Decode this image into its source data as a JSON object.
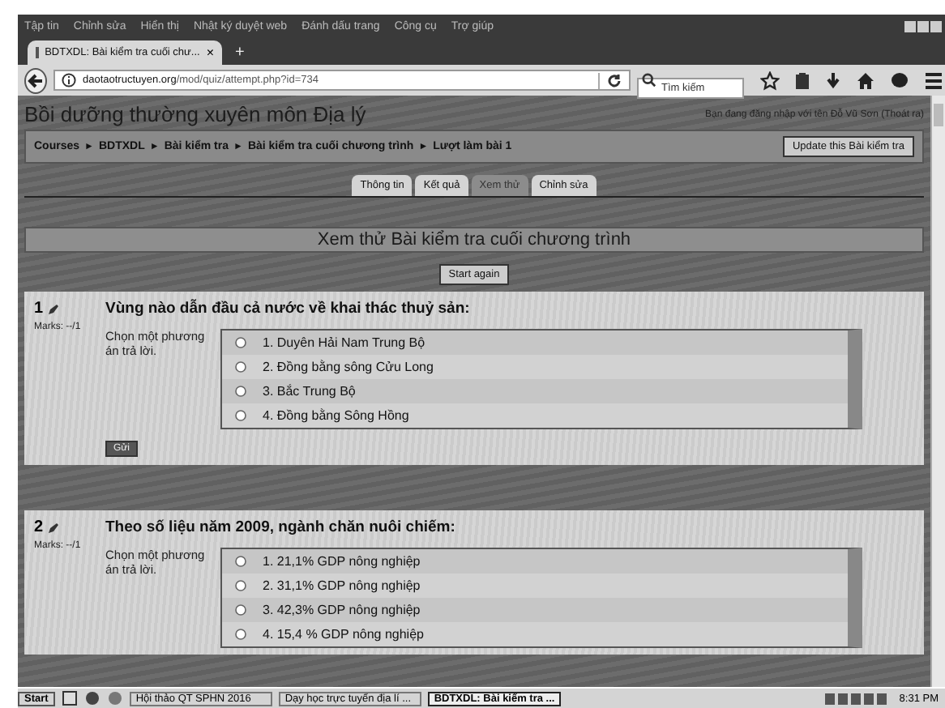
{
  "browser": {
    "menu": [
      "Tập tin",
      "Chỉnh sửa",
      "Hiển thị",
      "Nhật ký duyệt web",
      "Đánh dấu trang",
      "Công cụ",
      "Trợ giúp"
    ],
    "tab": {
      "title": "BDTXDL: Bài kiểm tra cuối chư...",
      "close": "×",
      "new_tab": "+"
    },
    "url": {
      "domain": "daotaotructuyen.org",
      "path": "/mod/quiz/attempt.php?id=734"
    },
    "search": {
      "placeholder": "Tìm kiếm"
    }
  },
  "site": {
    "title": "Bồi dưỡng thường xuyên môn Địa lý",
    "login_text": "Bạn đang đăng nhập với tên Đỗ Vũ Sơn (",
    "logout_link": "Thoát ra",
    "login_end": ")"
  },
  "breadcrumbs": [
    "Courses",
    "BDTXDL",
    "Bài kiểm tra",
    "Bài kiểm tra cuối chương trình",
    "Lượt làm bài 1"
  ],
  "breadcrumb_separator": "►",
  "update_button": "Update this Bài kiểm tra",
  "tabs": [
    {
      "label": "Thông tin",
      "selected": false
    },
    {
      "label": "Kết quả",
      "selected": false
    },
    {
      "label": "Xem thử",
      "selected": true
    },
    {
      "label": "Chỉnh sửa",
      "selected": false
    }
  ],
  "heading": "Xem thử Bài kiểm tra cuối chương trình",
  "start_again": "Start again",
  "questions": [
    {
      "number": "1",
      "marks": "Marks: --/1",
      "prompt": "Chọn một phương án trả lời.",
      "text": "Vùng nào dẫn đầu cả nước về khai thác thuỷ sản:",
      "submit": "Gửi",
      "options": [
        {
          "label": "1. Duyên Hải Nam Trung Bộ",
          "selected": false
        },
        {
          "label": "2. Đồng bằng sông Cửu Long",
          "selected": false
        },
        {
          "label": "3. Bắc Trung Bộ",
          "selected": false
        },
        {
          "label": "4. Đồng bằng Sông Hồng",
          "selected": false
        }
      ]
    },
    {
      "number": "2",
      "marks": "Marks: --/1",
      "prompt": "Chọn một phương án trả lời.",
      "text": "Theo số liệu năm 2009, ngành chăn nuôi chiếm:",
      "options": [
        {
          "label": "1. 21,1% GDP nông nghiệp",
          "selected": false
        },
        {
          "label": "2. 31,1% GDP nông nghiệp",
          "selected": false
        },
        {
          "label": "3. 42,3% GDP nông nghiệp",
          "selected": false
        },
        {
          "label": "4. 15,4 % GDP nông nghiệp",
          "selected": false
        }
      ]
    }
  ],
  "taskbar": {
    "start": "Start",
    "windows": [
      {
        "label": "Hội thảo QT SPHN 2016",
        "selected": false
      },
      {
        "label": "Dạy học trực tuyến địa lí ...",
        "selected": false
      },
      {
        "label": "BDTXDL: Bài kiểm tra ...",
        "selected": true
      }
    ],
    "clock": "8:31 PM"
  }
}
